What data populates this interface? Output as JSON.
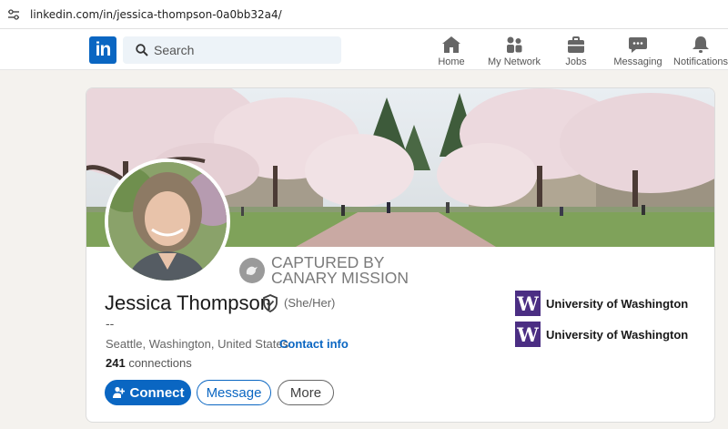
{
  "browser": {
    "url": "linkedin.com/in/jessica-thompson-0a0bb32a4/",
    "icon": "tune-icon"
  },
  "nav": {
    "logo": "in",
    "search_placeholder": "Search",
    "items": [
      {
        "label": "Home",
        "icon": "home-icon"
      },
      {
        "label": "My Network",
        "icon": "network-icon"
      },
      {
        "label": "Jobs",
        "icon": "briefcase-icon"
      },
      {
        "label": "Messaging",
        "icon": "message-icon"
      },
      {
        "label": "Notifications",
        "icon": "bell-icon"
      }
    ]
  },
  "profile": {
    "name": "Jessica Thompson",
    "pronouns": "(She/Her)",
    "headline": "--",
    "location": "Seattle, Washington, United States ·",
    "contact_info": "Contact info",
    "connections_count": "241",
    "connections_label": "connections",
    "watermark": [
      "CAPTURED BY",
      "CANARY MISSION"
    ]
  },
  "actions": {
    "connect": "Connect",
    "message": "Message",
    "more": "More"
  },
  "education": [
    {
      "logo": "W",
      "name": "University of Washington"
    },
    {
      "logo": "W",
      "name": "University of Washington"
    }
  ],
  "colors": {
    "brand": "#0a66c2",
    "uw_purple": "#4b2e83",
    "background": "#f4f2ee"
  }
}
